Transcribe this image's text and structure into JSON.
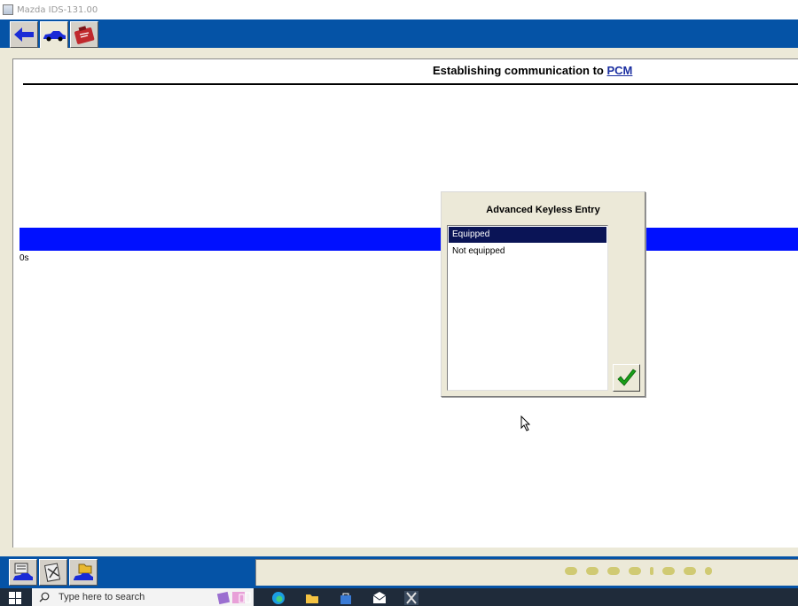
{
  "window": {
    "title": "Mazda IDS-131.00"
  },
  "toolbar": {
    "tools": [
      {
        "icon": "back-arrow-icon"
      },
      {
        "icon": "vehicle-icon"
      },
      {
        "icon": "toolbox-icon"
      }
    ]
  },
  "page": {
    "title_prefix": "Establishing communication to",
    "title_link": "PCM",
    "elapsed": "0s"
  },
  "dialog": {
    "title": "Advanced Keyless Entry",
    "options": [
      "Equipped",
      "Not equipped"
    ],
    "selected_index": 0,
    "ok_icon": "checkmark-icon"
  },
  "bottombar": {
    "tools": [
      {
        "icon": "vehicle-session-icon"
      },
      {
        "icon": "tools-icon"
      },
      {
        "icon": "open-folder-vehicle-icon"
      }
    ]
  },
  "taskbar": {
    "search_placeholder": "Type here to search"
  },
  "colors": {
    "toolbar_blue": "#0553a6",
    "progress_blue": "#0010ff",
    "selection_navy": "#0a1456",
    "link_blue": "#1a2ea0"
  }
}
